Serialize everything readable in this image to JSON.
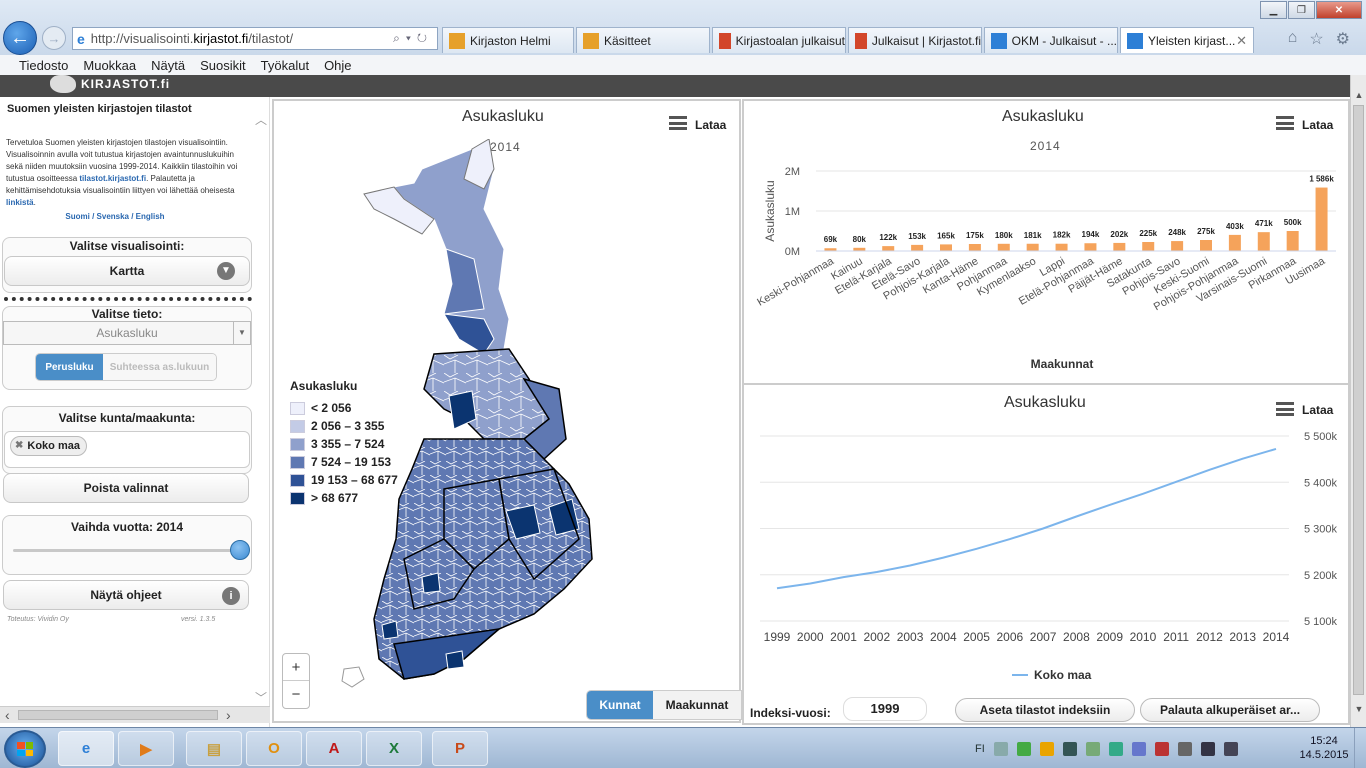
{
  "browser": {
    "url_prefix": "http://visualisointi.",
    "url_domain": "kirjastot.fi",
    "url_suffix": "/tilastot/",
    "tabs": [
      {
        "label": "Kirjaston Helmi",
        "icon_color": "#e6a02a"
      },
      {
        "label": "Käsitteet",
        "icon_color": "#e6a02a"
      },
      {
        "label": "Kirjastoalan julkaisut",
        "icon_color": "#d2462a"
      },
      {
        "label": "Julkaisut | Kirjastot.fi",
        "icon_color": "#d2462a"
      },
      {
        "label": "OKM - Julkaisut - ...",
        "icon_color": "#2d7fd6"
      },
      {
        "label": "Yleisten kirjast...",
        "icon_color": "#2d7fd6"
      }
    ],
    "menu": [
      "Tiedosto",
      "Muokkaa",
      "Näytä",
      "Suosikit",
      "Työkalut",
      "Ohje"
    ]
  },
  "site": {
    "logo": "KIRJASTOT.fi"
  },
  "sidebar": {
    "title": "Suomen yleisten kirjastojen tilastot",
    "intro_1": "Tervetuloa Suomen yleisten kirjastojen tilastojen visualisointiin. Visualisoinnin avulla voit tutustua kirjastojen avaintunnuslukuihin sekä niiden muutoksiin vuosina 1999-2014. Kaikkiin tilastoihin voi tutustua osoitteessa ",
    "intro_link_1": "tilastot.kirjastot.fi",
    "intro_2": ". Palautetta ja kehittämisehdotuksia visualisointiin liittyen voi lähettää oheisesta ",
    "intro_link_2": "linkistä",
    "intro_3": ".",
    "languages": "Suomi / Svenska / English",
    "visualisointi_label": "Valitse visualisointi:",
    "visualisointi_value": "Kartta",
    "tieto_label": "Valitse tieto:",
    "tieto_value": "Asukasluku",
    "seg_on": "Perusluku",
    "seg_off": "Suhteessa as.lukuun",
    "kunta_label": "Valitse kunta/maakunta:",
    "chip": "Koko maa",
    "poista": "Poista valinnat",
    "vuosi_label": "Vaihda vuotta: 2014",
    "ohjeet": "Näytä ohjeet",
    "credit_left": "Toteutus: Vividin Oy",
    "credit_right": "versi. 1.3.5"
  },
  "map": {
    "title": "Asukasluku",
    "subtitle": "2014",
    "download": "Lataa",
    "legend_title": "Asukasluku",
    "legend": [
      {
        "label": "< 2 056",
        "color": "#eef0fb"
      },
      {
        "label": "2 056 – 3 355",
        "color": "#c3cbe6"
      },
      {
        "label": "3 355 – 7 524",
        "color": "#8fa0cc"
      },
      {
        "label": "7 524 – 19 153",
        "color": "#5f78b2"
      },
      {
        "label": "19 153 – 68 677",
        "color": "#2f5296"
      },
      {
        "label": "> 68 677",
        "color": "#0b3470"
      }
    ],
    "zoom_in": "+",
    "zoom_out": "−",
    "seg_on": "Kunnat",
    "seg_off": "Maakunnat"
  },
  "bar_panel": {
    "title": "Asukasluku",
    "subtitle": "2014",
    "download": "Lataa",
    "bar_color": "#f5a35b"
  },
  "line_panel": {
    "title": "Asukasluku",
    "download": "Lataa",
    "line_color": "#7cb5ec"
  },
  "chart_data": [
    {
      "type": "bar",
      "title": "Asukasluku",
      "subtitle": "2014",
      "xlabel": "Maakunnat",
      "ylabel": "Asukasluku",
      "ylim": [
        0,
        2000000
      ],
      "yticks": [
        "0M",
        "1M",
        "2M"
      ],
      "categories": [
        "Keski-Pohjanmaa",
        "Kainuu",
        "Etelä-Karjala",
        "Etelä-Savo",
        "Pohjois-Karjala",
        "Kanta-Häme",
        "Pohjanmaa",
        "Kymenlaakso",
        "Lappi",
        "Etelä-Pohjanmaa",
        "Päijät-Häme",
        "Satakunta",
        "Pohjois-Savo",
        "Keski-Suomi",
        "Pohjois-Pohjanmaa",
        "Varsinais-Suomi",
        "Pirkanmaa",
        "Uusimaa"
      ],
      "values": [
        69000,
        80000,
        122000,
        153000,
        165000,
        175000,
        180000,
        181000,
        182000,
        194000,
        202000,
        225000,
        248000,
        275000,
        403000,
        471000,
        500000,
        1586000
      ],
      "data_labels": [
        "69k",
        "80k",
        "122k",
        "153k",
        "165k",
        "175k",
        "180k",
        "181k",
        "182k",
        "194k",
        "202k",
        "225k",
        "248k",
        "275k",
        "403k",
        "471k",
        "500k",
        "1 586k"
      ]
    },
    {
      "type": "line",
      "title": "Asukasluku",
      "x": [
        "1999",
        "2000",
        "2001",
        "2002",
        "2003",
        "2004",
        "2005",
        "2006",
        "2007",
        "2008",
        "2009",
        "2010",
        "2011",
        "2012",
        "2013",
        "2014"
      ],
      "series": [
        {
          "name": "Koko maa",
          "values": [
            5171000,
            5181000,
            5195000,
            5206000,
            5220000,
            5237000,
            5256000,
            5277000,
            5300000,
            5326000,
            5351000,
            5375000,
            5401000,
            5427000,
            5451000,
            5472000
          ]
        }
      ],
      "ylim": [
        5100000,
        5500000
      ],
      "yticks": [
        "5 100k",
        "5 200k",
        "5 300k",
        "5 400k",
        "5 500k"
      ]
    }
  ],
  "bottom": {
    "index_label": "Indeksi-vuosi:",
    "index_value": "1999",
    "set_index": "Aseta tilastot indeksiin",
    "restore": "Palauta alkuperäiset ar..."
  },
  "taskbar": {
    "lang": "FI",
    "time": "15:24",
    "date": "14.5.2015"
  }
}
